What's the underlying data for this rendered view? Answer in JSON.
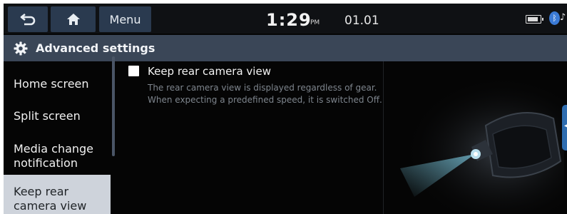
{
  "topbar": {
    "menu_label": "Menu",
    "time": "1:29",
    "ampm": "PM",
    "date": "01.01",
    "icons": [
      "back-icon",
      "home-icon",
      "battery-icon",
      "bluetooth-icon",
      "music-note-icon"
    ]
  },
  "titlebar": {
    "title": "Advanced settings",
    "icon": "gear-icon"
  },
  "sidebar": {
    "items": [
      {
        "label": "Home screen"
      },
      {
        "label": "Split screen"
      },
      {
        "label": "Media change notification"
      },
      {
        "label": "Keep rear camera view",
        "selected": true
      }
    ]
  },
  "main": {
    "option": {
      "label": "Keep rear camera view",
      "checked": false,
      "description": "The rear camera view is displayed regardless of gear. When expecting a predefined speed, it is switched Off."
    }
  },
  "colors": {
    "background": "#050505",
    "topbar_button": "#2a3a4f",
    "titlebar": "#3a4657",
    "sidebar_selected": "#ced3db",
    "accent": "#2f6db0"
  }
}
